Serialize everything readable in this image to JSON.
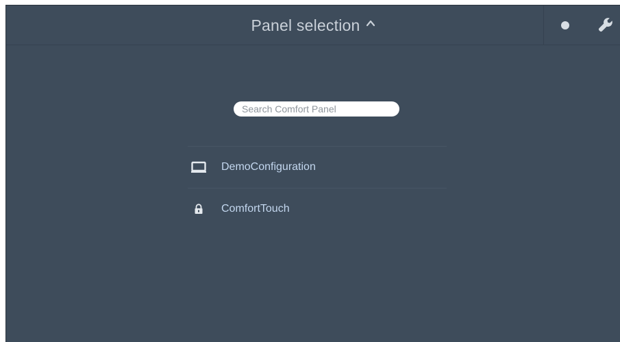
{
  "header": {
    "title": "Panel selection"
  },
  "search": {
    "placeholder": "Search Comfort Panel"
  },
  "panels": [
    {
      "label": "DemoConfiguration",
      "icon": "monitor-icon"
    },
    {
      "label": "ComfortTouch",
      "icon": "lock-icon"
    }
  ],
  "colors": {
    "background": "#3e4c5b",
    "title_text": "#c9d0d8",
    "item_text": "#c3d7ef",
    "divider": "#475565"
  }
}
